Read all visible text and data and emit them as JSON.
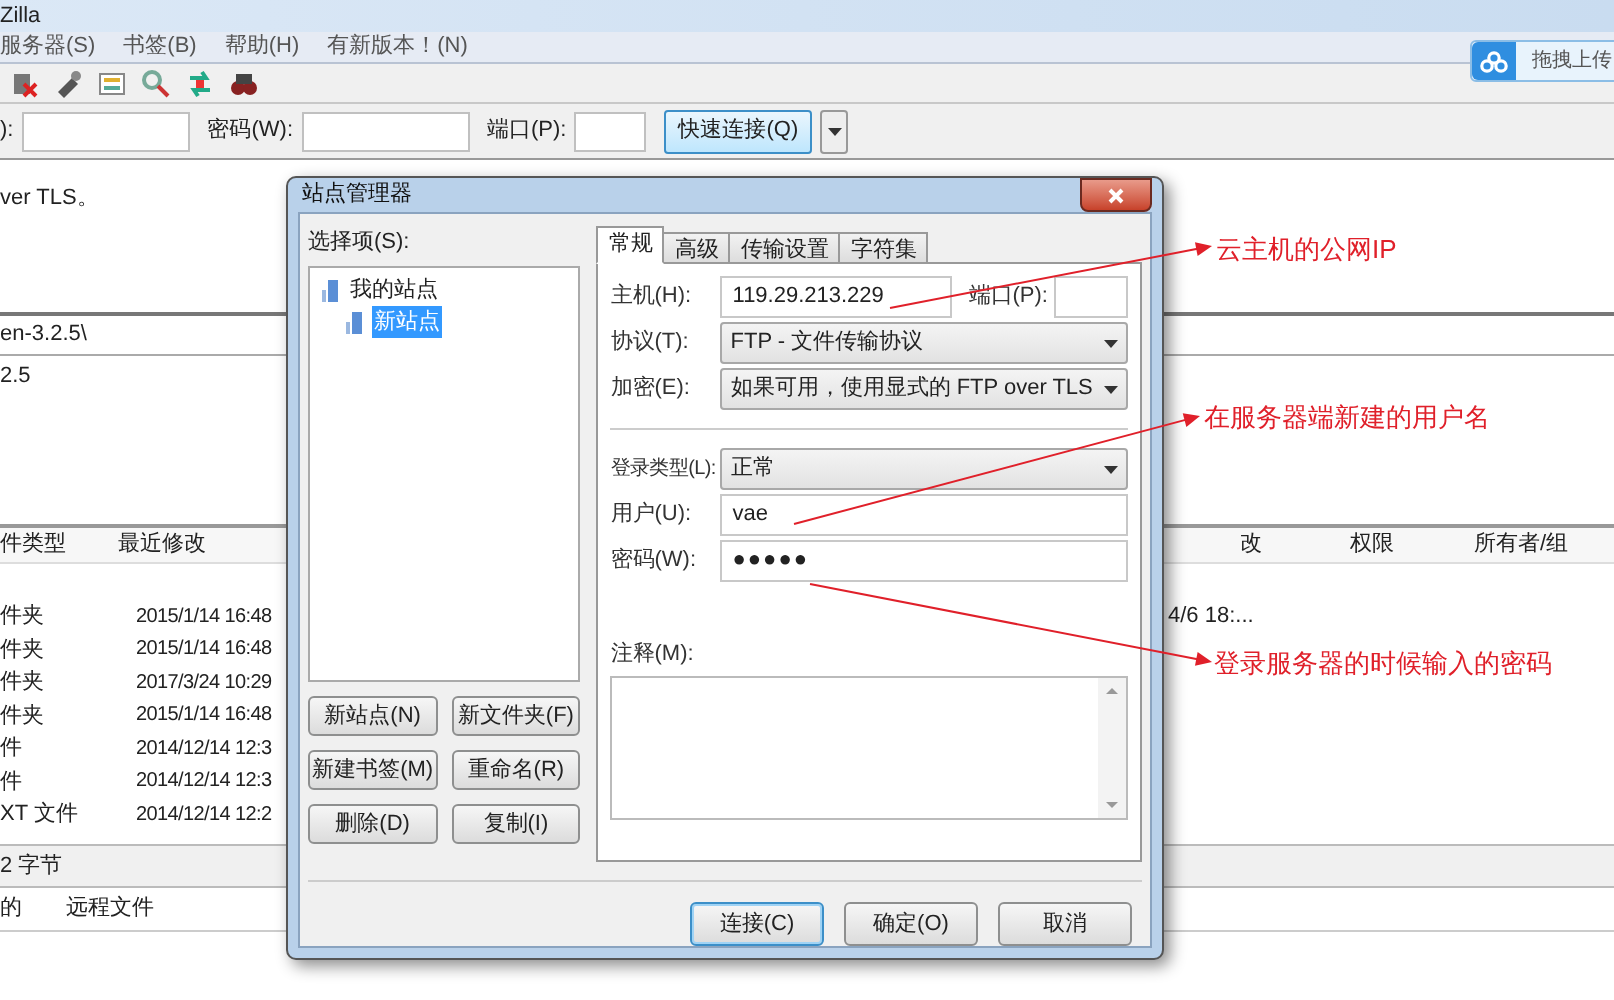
{
  "window": {
    "title": "Zilla"
  },
  "menu": [
    "服务器(S)",
    "书签(B)",
    "帮助(H)",
    "有新版本！(N)"
  ],
  "upload_widget": {
    "label": "拖拽上传"
  },
  "quickconnect": {
    "fields": [
      {
        "label": "):"
      },
      {
        "label": "密码(W):"
      },
      {
        "label": "端口(P):"
      }
    ],
    "button": "快速连接(Q)"
  },
  "message_log": [
    "ver TLS。"
  ],
  "local_path": "en-3.2.5\\",
  "local_tree": [
    "2.5"
  ],
  "local_files": {
    "columns": [
      "件类型",
      "最近修改"
    ],
    "rows": [
      [
        "件夹",
        "2015/1/14 16:48"
      ],
      [
        "件夹",
        "2015/1/14 16:48"
      ],
      [
        "件夹",
        "2017/3/24 10:29"
      ],
      [
        "件夹",
        "2015/1/14 16:48"
      ],
      [
        "件",
        "2014/12/14 12:3"
      ],
      [
        "件",
        "2014/12/14 12:3"
      ],
      [
        "XT 文件",
        "2014/12/14 12:2"
      ]
    ]
  },
  "remote_files": {
    "columns": [
      "改",
      "权限",
      "所有者/组"
    ],
    "rows": [
      [
        "4/6 18:..."
      ]
    ]
  },
  "status_bar": "2 字节",
  "queue_tabs": [
    "的",
    "远程文件"
  ],
  "site_manager": {
    "title": "站点管理器",
    "tree_label": "选择项(S):",
    "tree": [
      {
        "label": "我的站点",
        "selected": false,
        "children": [
          {
            "label": "新站点",
            "selected": true
          }
        ]
      }
    ],
    "tree_buttons": [
      "新站点(N)",
      "新文件夹(F)",
      "新建书签(M)",
      "重命名(R)",
      "删除(D)",
      "复制(I)"
    ],
    "tabs": [
      {
        "label": "常规",
        "selected": true
      },
      {
        "label": "高级",
        "selected": false
      },
      {
        "label": "传输设置",
        "selected": false
      },
      {
        "label": "字符集",
        "selected": false
      }
    ],
    "host": {
      "label": "主机(H):",
      "value": "119.29.213.229"
    },
    "port": {
      "label": "端口(P):"
    },
    "protocol": {
      "label": "协议(T):",
      "value": "FTP - 文件传输协议"
    },
    "encryption": {
      "label": "加密(E):",
      "value": "如果可用，使用显式的 FTP over TLS"
    },
    "logon_type": {
      "label": "登录类型(L):",
      "value": "正常"
    },
    "user": {
      "label": "用户(U):",
      "value": "vae"
    },
    "password": {
      "label": "密码(W):",
      "value": "●●●●●"
    },
    "comments": {
      "label": "注释(M):"
    },
    "buttons": [
      {
        "label": "连接(C)",
        "default": true
      },
      {
        "label": "确定(O)",
        "default": false
      },
      {
        "label": "取消",
        "default": false
      }
    ]
  },
  "annotations": [
    "云主机的公网IP",
    "在服务器端新建的用户名",
    "登录服务器的时候输入的密码"
  ]
}
